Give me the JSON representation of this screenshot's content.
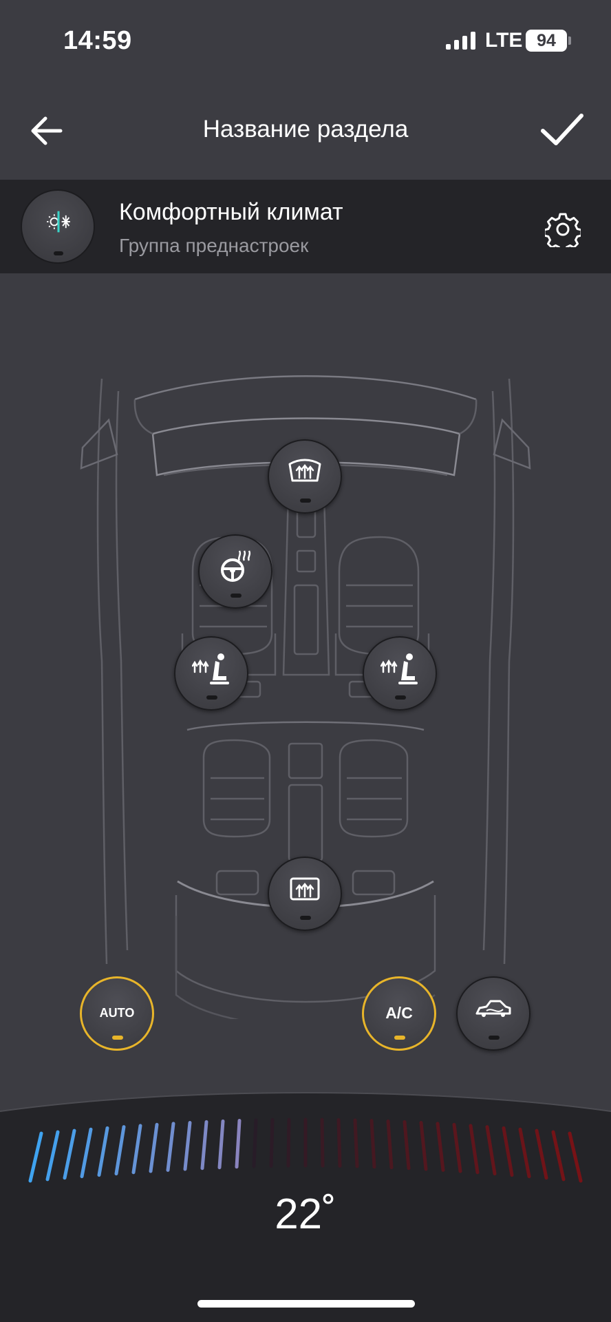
{
  "status_bar": {
    "time": "14:59",
    "network": "LTE",
    "battery": "94"
  },
  "nav": {
    "back_icon": "arrow-left-icon",
    "title": "Название раздела",
    "confirm_icon": "checkmark-icon"
  },
  "preset": {
    "icon": "sun-snowflake-icon",
    "name": "Комфортный климат",
    "subtitle": "Группа преднастроек",
    "settings_icon": "gear-icon"
  },
  "controls": {
    "front_defrost": {
      "icon": "windshield-defrost-icon",
      "active": false
    },
    "steering_heat": {
      "icon": "heated-steering-wheel-icon",
      "active": false
    },
    "driver_seat_heat": {
      "icon": "heated-seat-icon",
      "active": false
    },
    "passenger_seat_heat": {
      "icon": "heated-seat-icon",
      "active": false
    },
    "rear_defrost": {
      "icon": "rear-window-defrost-icon",
      "active": false
    },
    "auto": {
      "label": "AUTO",
      "active": true
    },
    "ac": {
      "label": "A/C",
      "active": true
    },
    "recirculation": {
      "icon": "car-air-recirculation-icon",
      "active": false
    }
  },
  "temperature": {
    "value": "22˚",
    "level": 0.4
  },
  "colors": {
    "accent": "#e8b52a",
    "cold": "#3fa3f0",
    "hot": "#c23131",
    "background": "#3c3c42",
    "panel": "#242428"
  }
}
